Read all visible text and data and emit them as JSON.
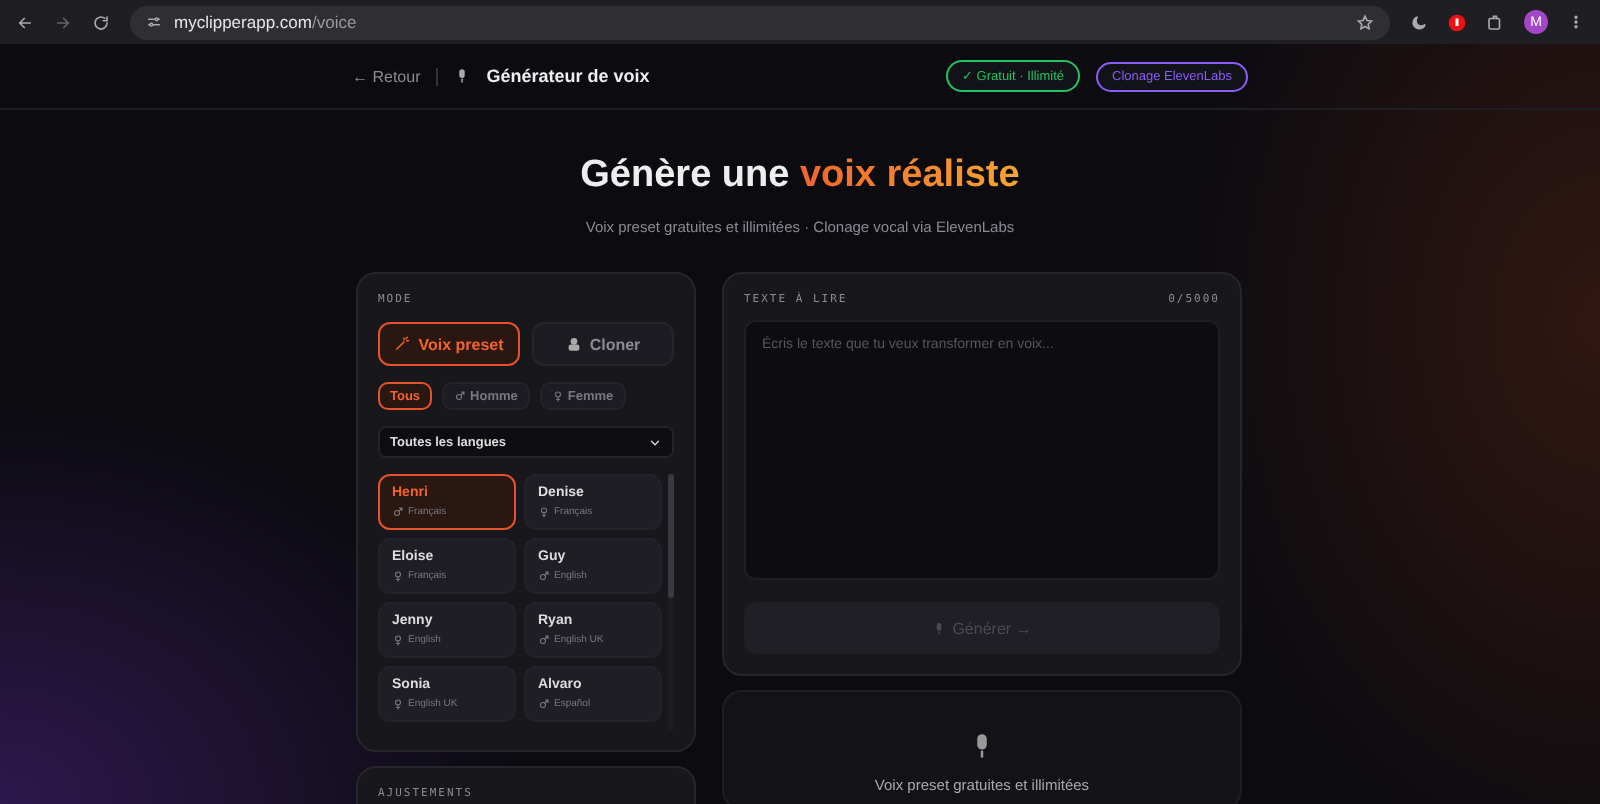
{
  "browser": {
    "url_host": "myclipperapp.com",
    "url_path": "/voice",
    "avatar": "M"
  },
  "header": {
    "back": "← Retour",
    "title": "Générateur de voix",
    "badges": [
      {
        "text": "✓ Gratuit · Illimité",
        "kind": "free"
      },
      {
        "text": "Clonage ElevenLabs",
        "kind": "premium"
      }
    ]
  },
  "hero": {
    "title_start": "Génère une",
    "title_accent": "voix réaliste",
    "subtitle": "Voix preset gratuites et illimitées · Clonage vocal via ElevenLabs"
  },
  "mode_panel": {
    "label": "MODE",
    "modes": [
      {
        "label": "Voix preset",
        "selected": true,
        "kind": "wand"
      },
      {
        "label": "Cloner",
        "selected": false,
        "kind": "clone"
      }
    ],
    "filters": [
      {
        "label": "Tous",
        "selected": true,
        "kind": "all"
      },
      {
        "label": "Homme",
        "selected": false,
        "kind": "male"
      },
      {
        "label": "Femme",
        "selected": false,
        "kind": "female"
      }
    ],
    "language_select": "Toutes les langues",
    "voices": [
      {
        "name": "Henri",
        "language": "Français",
        "kind": "male",
        "selected": true
      },
      {
        "name": "Denise",
        "language": "Français",
        "kind": "female",
        "selected": false
      },
      {
        "name": "Eloise",
        "language": "Français",
        "kind": "female",
        "selected": false
      },
      {
        "name": "Guy",
        "language": "English",
        "kind": "male",
        "selected": false
      },
      {
        "name": "Jenny",
        "language": "English",
        "kind": "female",
        "selected": false
      },
      {
        "name": "Ryan",
        "language": "English UK",
        "kind": "male",
        "selected": false
      },
      {
        "name": "Sonia",
        "language": "English UK",
        "kind": "female",
        "selected": false
      },
      {
        "name": "Alvaro",
        "language": "Español",
        "kind": "male",
        "selected": false
      }
    ]
  },
  "adjust_panel": {
    "label": "AJUSTEMENTS"
  },
  "text_panel": {
    "label": "TEXTE À LIRE",
    "counter": "0/5000",
    "placeholder": "Écris le texte que tu veux transformer en voix...",
    "generate": {
      "label": "Générer →",
      "disabled": true
    }
  },
  "result_panel": {
    "text": "Voix preset gratuites et illimitées"
  }
}
